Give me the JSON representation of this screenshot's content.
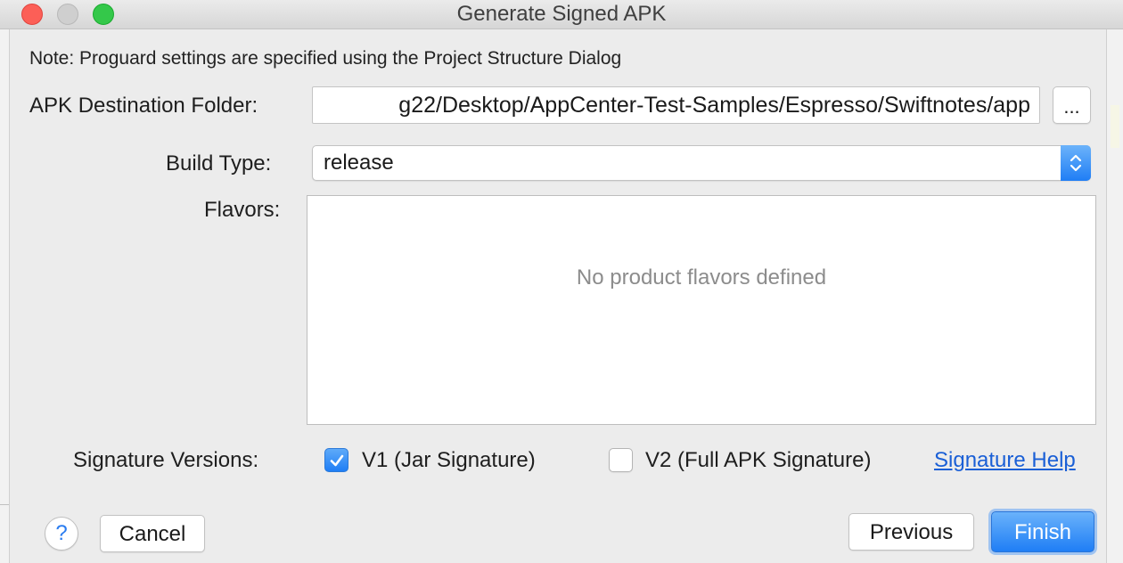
{
  "window": {
    "title": "Generate Signed APK"
  },
  "note": "Note: Proguard settings are specified using the Project Structure Dialog",
  "destination": {
    "label": "APK Destination Folder:",
    "value": "g22/Desktop/AppCenter-Test-Samples/Espresso/Swiftnotes/app",
    "browse_label": "..."
  },
  "build_type": {
    "label": "Build Type:",
    "selected": "release"
  },
  "flavors": {
    "label": "Flavors:",
    "empty_text": "No product flavors defined"
  },
  "signature": {
    "label": "Signature Versions:",
    "v1_label": "V1 (Jar Signature)",
    "v1_checked": true,
    "v2_label": "V2 (Full APK Signature)",
    "v2_checked": false,
    "help_link": "Signature Help"
  },
  "buttons": {
    "help": "?",
    "cancel": "Cancel",
    "previous": "Previous",
    "finish": "Finish"
  },
  "colors": {
    "accent": "#1f7ef5",
    "link": "#1a5fd6",
    "close": "#fc5f57",
    "zoom": "#34c84a"
  }
}
